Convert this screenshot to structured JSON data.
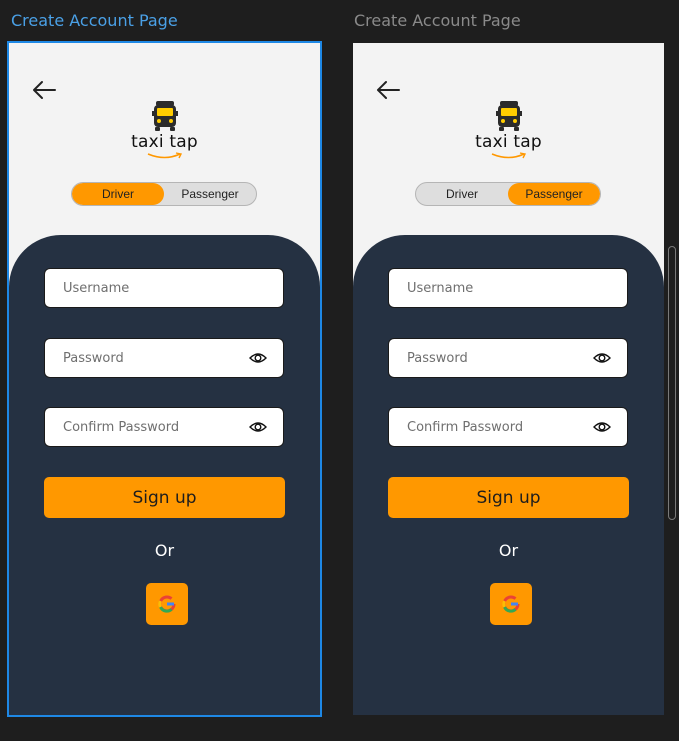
{
  "frames": [
    {
      "title": "Create Account Page",
      "brand": "taxi tap",
      "toggle": {
        "left": "Driver",
        "right": "Passenger",
        "selected": "left"
      },
      "fields": {
        "username": "Username",
        "password": "Password",
        "confirm": "Confirm Password"
      },
      "signup_label": "Sign up",
      "or_label": "Or"
    },
    {
      "title": "Create Account Page",
      "brand": "taxi tap",
      "toggle": {
        "left": "Driver",
        "right": "Passenger",
        "selected": "right"
      },
      "fields": {
        "username": "Username",
        "password": "Password",
        "confirm": "Confirm Password"
      },
      "signup_label": "Sign up",
      "or_label": "Or"
    }
  ],
  "colors": {
    "accent": "#ff9800",
    "panel": "#253142",
    "selection": "#1e88e5"
  },
  "icons": {
    "back": "arrow-left-icon",
    "logo": "taxi-icon",
    "eye": "eye-icon",
    "google": "google-icon"
  }
}
